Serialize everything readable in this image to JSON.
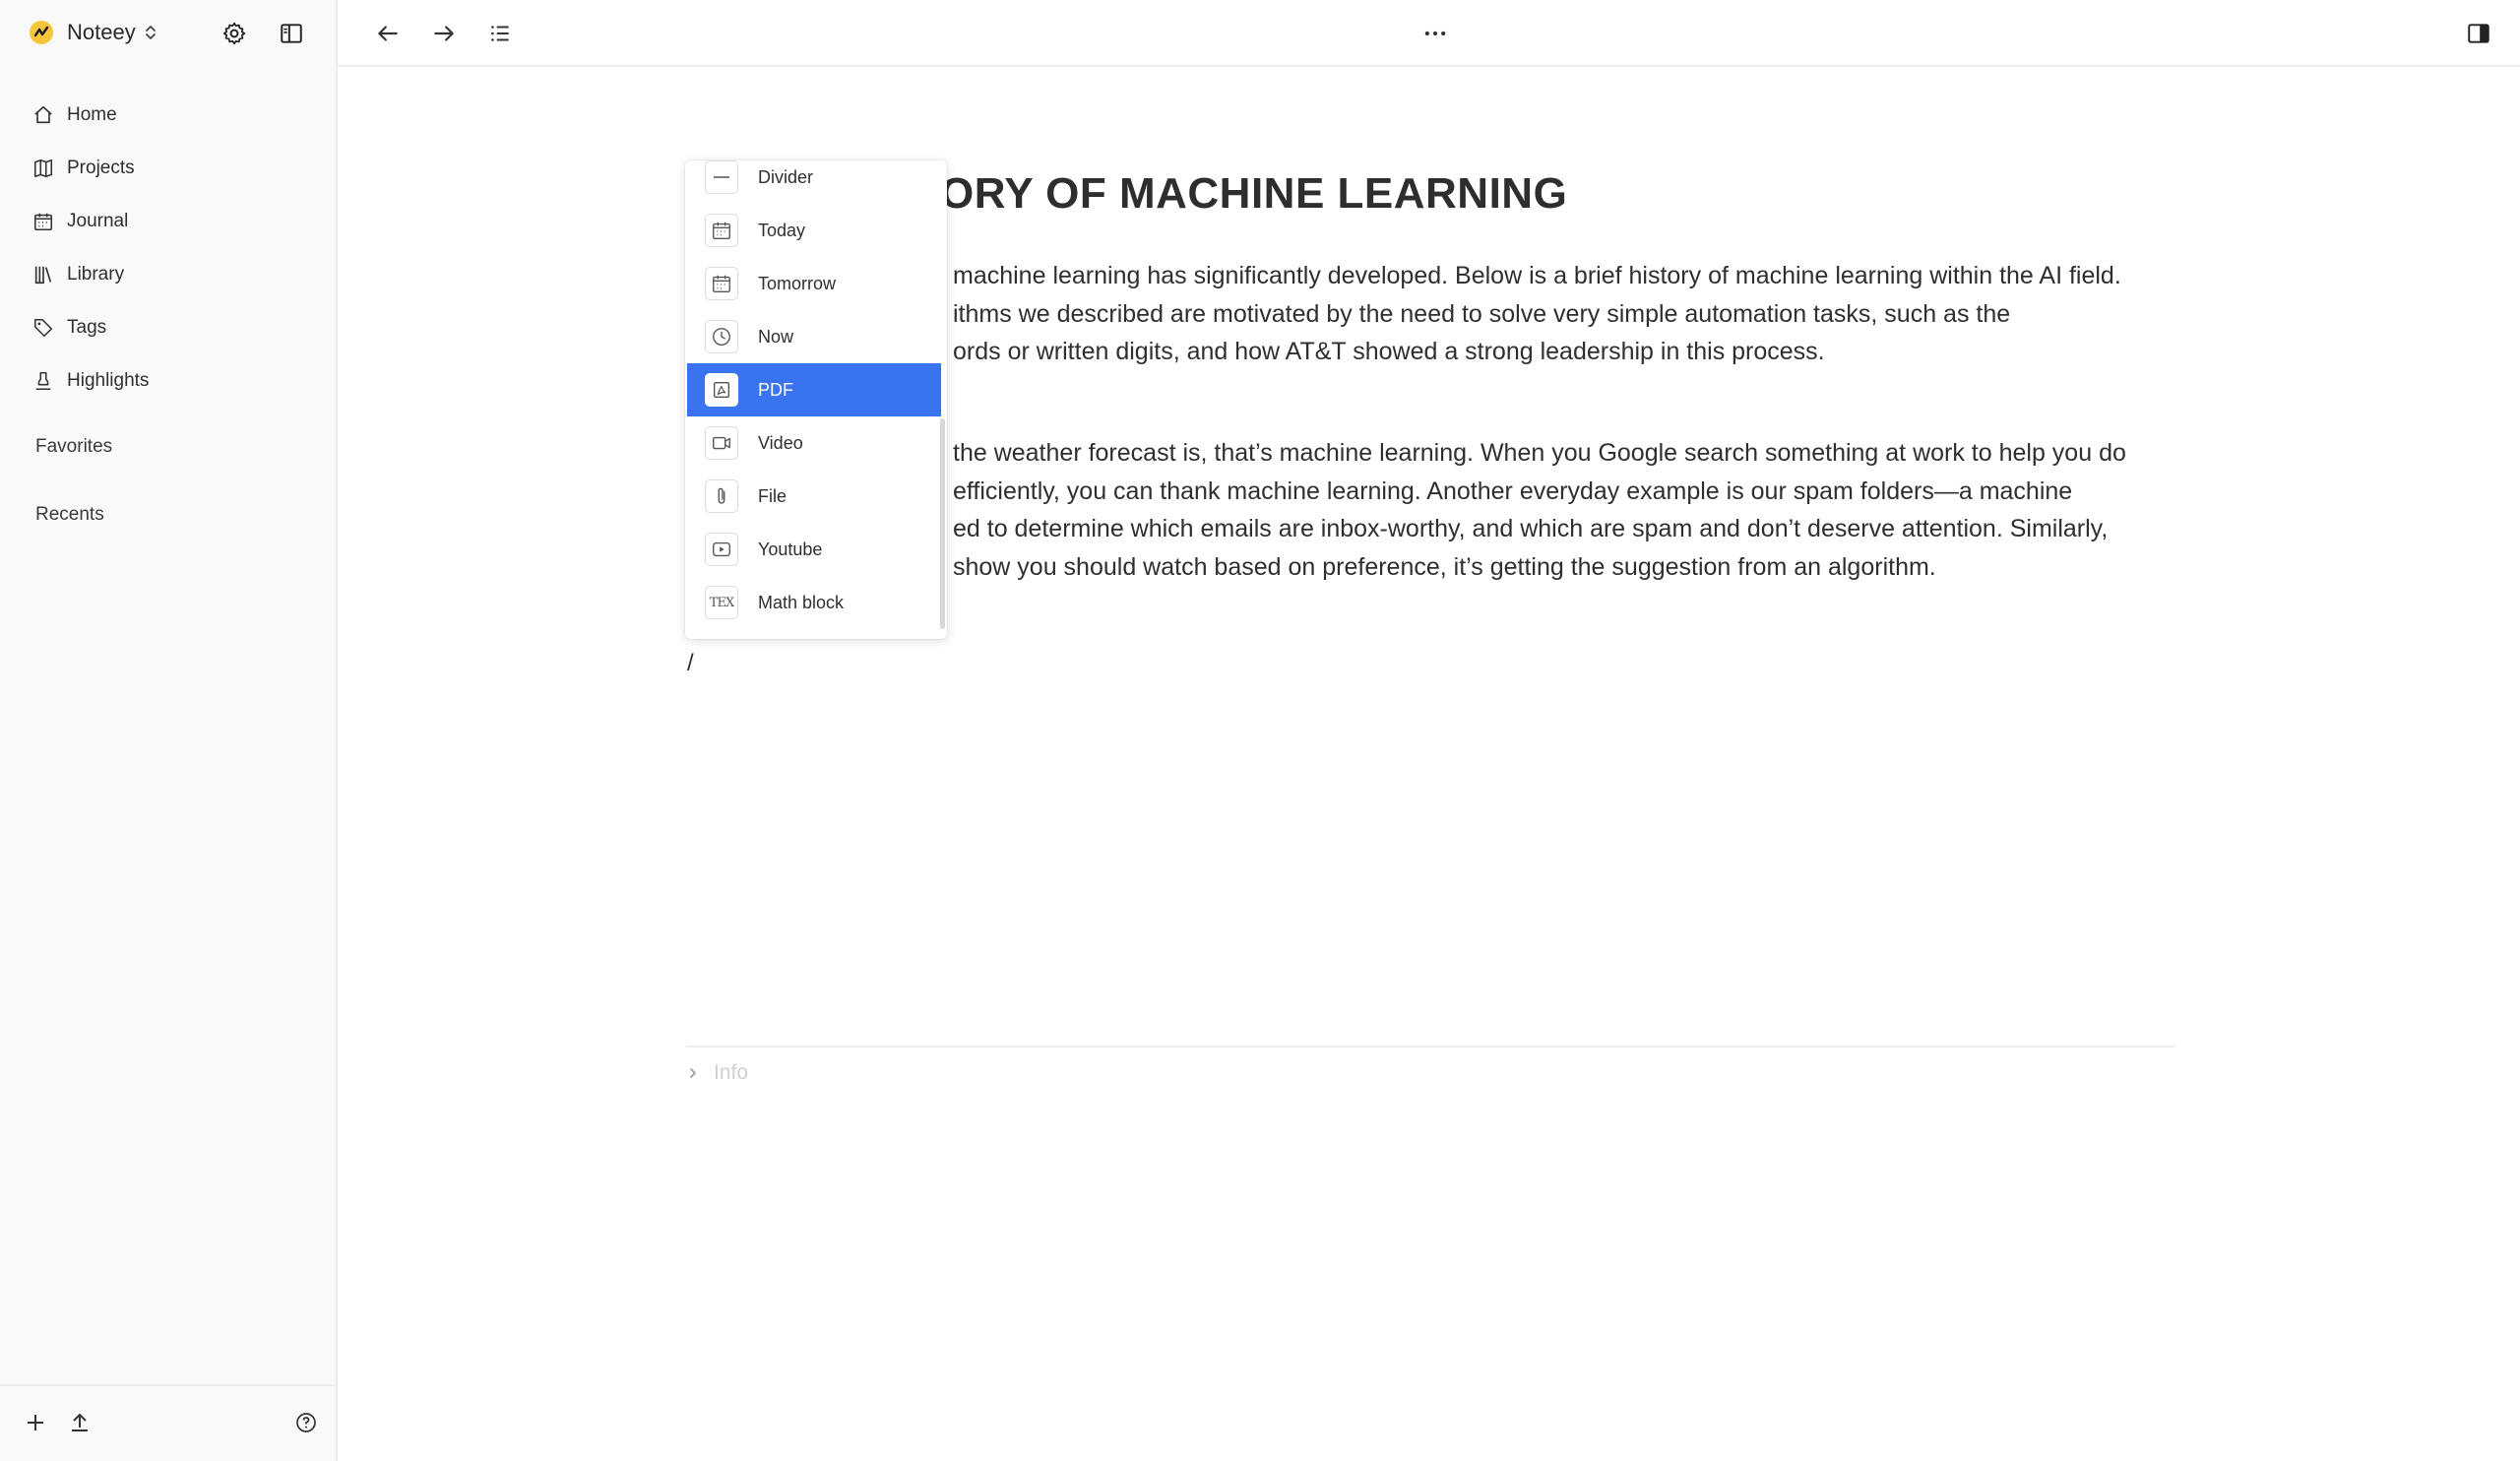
{
  "sidebar": {
    "brand": {
      "name": "Noteey",
      "icon": "noteey-logo-icon"
    },
    "nav": [
      {
        "label": "Home",
        "icon": "home-icon"
      },
      {
        "label": "Projects",
        "icon": "map-icon"
      },
      {
        "label": "Journal",
        "icon": "calendar-icon"
      },
      {
        "label": "Library",
        "icon": "library-icon"
      },
      {
        "label": "Tags",
        "icon": "tag-icon"
      },
      {
        "label": "Highlights",
        "icon": "highlighter-icon"
      }
    ],
    "sections": {
      "favorites": "Favorites",
      "recents": "Recents"
    }
  },
  "document": {
    "title": "HISTORY OF MACHINE LEARNING",
    "title_visible": "ORY OF MACHINE LEARNING",
    "paragraph1": [
      "machine learning has significantly  developed. Below is a brief history of machine learning within the  AI field.",
      "ithms we described are motivated  by the need to solve very simple automation tasks, such as the",
      "ords or written digits, and how AT&T  showed a strong leadership in this process."
    ],
    "paragraph2": [
      "the weather forecast is, that’s machine learning. When  you Google search something at work to help you do",
      "efficiently, you can thank machine learning. Another everyday example is our  spam folders—a machine",
      "ed to determine which emails  are inbox-worthy, and which are spam and don’t deserve attention. Similarly,",
      "show you should watch based on preference, it’s getting  the suggestion from an algorithm."
    ],
    "input_text": "/",
    "info_label": "Info"
  },
  "slash_menu": {
    "selected_index": 4,
    "items": [
      {
        "label": "Divider",
        "icon": "divider-icon"
      },
      {
        "label": "Today",
        "icon": "calendar-icon"
      },
      {
        "label": "Tomorrow",
        "icon": "calendar-icon"
      },
      {
        "label": "Now",
        "icon": "clock-icon"
      },
      {
        "label": "PDF",
        "icon": "pdf-icon"
      },
      {
        "label": "Video",
        "icon": "video-icon"
      },
      {
        "label": "File",
        "icon": "paperclip-icon"
      },
      {
        "label": "Youtube",
        "icon": "youtube-icon"
      },
      {
        "label": "Math block",
        "icon": "tex-icon",
        "glyph": "TEX"
      }
    ]
  },
  "colors": {
    "accent": "#3874f0",
    "sidebar_bg": "#f9f9f9",
    "logo": "#f6c53a"
  }
}
